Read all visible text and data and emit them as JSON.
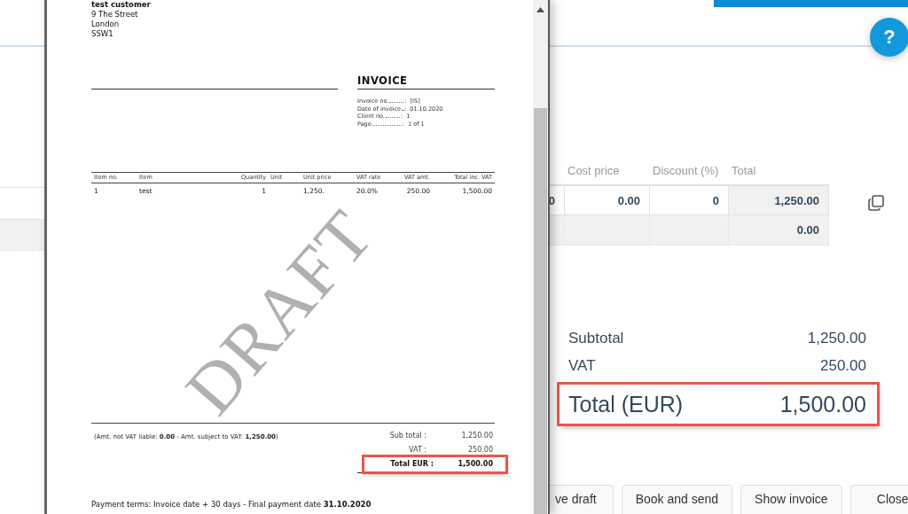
{
  "viewer": {
    "customer": {
      "name": "test customer",
      "lines": [
        "9 The Street",
        "London",
        "SSW1"
      ]
    },
    "title": "INVOICE",
    "meta_separator": ":",
    "meta": [
      {
        "label": "Invoice no.",
        "value": "[IS]"
      },
      {
        "label": "Date of invoice",
        "value": "01.10.2020"
      },
      {
        "label": "Client no.",
        "value": "1"
      },
      {
        "label": "Page",
        "value": "1 of 1"
      }
    ],
    "items": {
      "columns": [
        "Item no.",
        "Item",
        "Quantity",
        "Unit",
        "Unit price",
        "VAT rate",
        "VAT amt.",
        "Total inc. VAT"
      ],
      "rows": [
        [
          "1",
          "test",
          "1",
          null,
          "1,250.",
          "20.0%",
          "250.00",
          "1,500.00"
        ]
      ]
    },
    "watermark": "DRAFT",
    "vat_note": "(Amt. not VAT liable: **0.00** - Amt. subject to VAT: **1,250.00**)",
    "totals": [
      {
        "label": "Sub total :",
        "value": "1,250.00",
        "highlighted": false
      },
      {
        "label": "VAT :",
        "value": "250.00",
        "highlighted": false
      },
      {
        "label": "Total EUR :",
        "value": "1,500.00",
        "highlighted": true
      }
    ],
    "payment_terms": "Payment terms: Invoice date + 30 days - Final payment date **31.10.2020**"
  },
  "help": {
    "label": "?"
  },
  "line_items": {
    "columns": [
      "",
      "Cost price",
      "Discount (%)",
      "Total"
    ],
    "rows": [
      {
        "kind": "item",
        "cells": [
          "0",
          "0.00",
          "0",
          "1,250.00"
        ]
      },
      {
        "kind": "empty",
        "cells": [
          null,
          null,
          null,
          "0.00"
        ]
      }
    ]
  },
  "summary": [
    {
      "label": "Subtotal",
      "value": "1,250.00",
      "kind": "line",
      "highlighted": false
    },
    {
      "label": "VAT",
      "value": "250.00",
      "kind": "line",
      "highlighted": false
    },
    {
      "label": "Total (EUR)",
      "value": "1,500.00",
      "kind": "total",
      "highlighted": true
    }
  ],
  "buttons": [
    "ve draft",
    "Book and send",
    "Show invoice",
    "Close"
  ]
}
